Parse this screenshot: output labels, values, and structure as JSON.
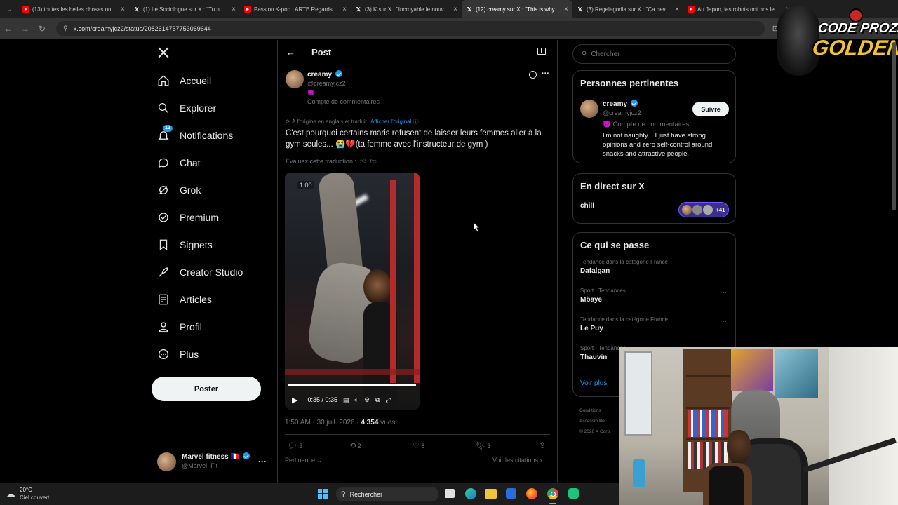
{
  "browser": {
    "tabs": [
      {
        "title": "(13) toutes les belles choses on",
        "favicon": "youtube-icon",
        "color": "#ff0000"
      },
      {
        "title": "(1) Le Sociologue sur X : \"Tu n",
        "favicon": "x-logo-icon",
        "color": "#000000"
      },
      {
        "title": "Passion K-pop | ARTE Regards",
        "favicon": "youtube-icon",
        "color": "#ff0000"
      },
      {
        "title": "(3) K sur X : \"Incroyable le nouv",
        "favicon": "x-logo-icon",
        "color": "#000000"
      },
      {
        "title": "(12) creamy sur X : \"This is why",
        "favicon": "x-logo-icon",
        "color": "#000000"
      },
      {
        "title": "(3) Regelegorila sur X : \"Ça dev",
        "favicon": "x-logo-icon",
        "color": "#000000"
      },
      {
        "title": "Au Japon, les robots ont pris le",
        "favicon": "youtube-icon",
        "color": "#ff0000"
      }
    ],
    "active_tab": 4,
    "url": "x.com/creamyjcz2/status/2082614757753069644"
  },
  "overlay_logo": {
    "line1": "CODE PROZIS",
    "line2": "GOLDENG"
  },
  "nav": {
    "items": [
      {
        "label": "Accueil",
        "icon": "home-icon"
      },
      {
        "label": "Explorer",
        "icon": "search-icon"
      },
      {
        "label": "Notifications",
        "icon": "bell-icon",
        "badge": "12"
      },
      {
        "label": "Chat",
        "icon": "chat-bubble-icon"
      },
      {
        "label": "Grok",
        "icon": "grok-icon"
      },
      {
        "label": "Premium",
        "icon": "premium-badge-icon"
      },
      {
        "label": "Signets",
        "icon": "bookmark-icon"
      },
      {
        "label": "Creator Studio",
        "icon": "rocket-icon"
      },
      {
        "label": "Articles",
        "icon": "article-icon"
      },
      {
        "label": "Profil",
        "icon": "person-icon"
      },
      {
        "label": "Plus",
        "icon": "more-circle-icon"
      }
    ],
    "post_button": "Poster",
    "account": {
      "name": "Marvel fitness",
      "flag": "🇫🇷",
      "handle": "@Marvel_Fit"
    }
  },
  "post": {
    "header_title": "Post",
    "author": {
      "name": "creamy",
      "handle": "@creamyjcz2",
      "emoji": "😈",
      "label": "Compte de commentaires"
    },
    "translation_note": "À l'origine en anglais et traduit",
    "show_original": "Afficher l'original",
    "text": "C'est pourquoi certains maris refusent de laisser leurs femmes aller à la gym seules... 😭💔(ta femme avec l'instructeur de gym )",
    "rate_translation": "Évaluez cette traduction :",
    "video": {
      "speed": "1.00",
      "time": "0:35 / 0:35",
      "progress": 1.0
    },
    "timestamp": "1:50 AM · 30 juil. 2026",
    "views_count": "4 354",
    "views_label": "vues",
    "stats": {
      "replies": "3",
      "reposts": "2",
      "likes": "8",
      "bookmarks": "3"
    },
    "sort_label": "Pertinence",
    "quotes_label": "Voir les citations"
  },
  "sidebar": {
    "search_placeholder": "Chercher",
    "relevant": {
      "title": "Personnes pertinentes",
      "name": "creamy",
      "handle": "@creamyjcz2",
      "follow": "Suivre",
      "label": "😈 Compte de commentaires",
      "bio": "I'm not naughty... I just have strong opinions and zero self-control around snacks and attractive people."
    },
    "live": {
      "title": "En direct sur X",
      "name": "chill",
      "count": "+41"
    },
    "trends": {
      "title": "Ce qui se passe",
      "items": [
        {
          "category": "Tendance dans la catégorie France",
          "name": "Dafalgan"
        },
        {
          "category": "Sport · Tendances",
          "name": "Mbaye"
        },
        {
          "category": "Tendance dans la catégorie France",
          "name": "Le Puy"
        },
        {
          "category": "Sport · Tendances",
          "name": "Thauvin"
        }
      ],
      "more": "Voir plus"
    },
    "footer": [
      "Conditions",
      "Accessibilité",
      "© 2026 X Corp."
    ]
  },
  "taskbar": {
    "weather_temp": "20°C",
    "weather_desc": "Ciel couvert",
    "search_label": "Rechercher"
  }
}
